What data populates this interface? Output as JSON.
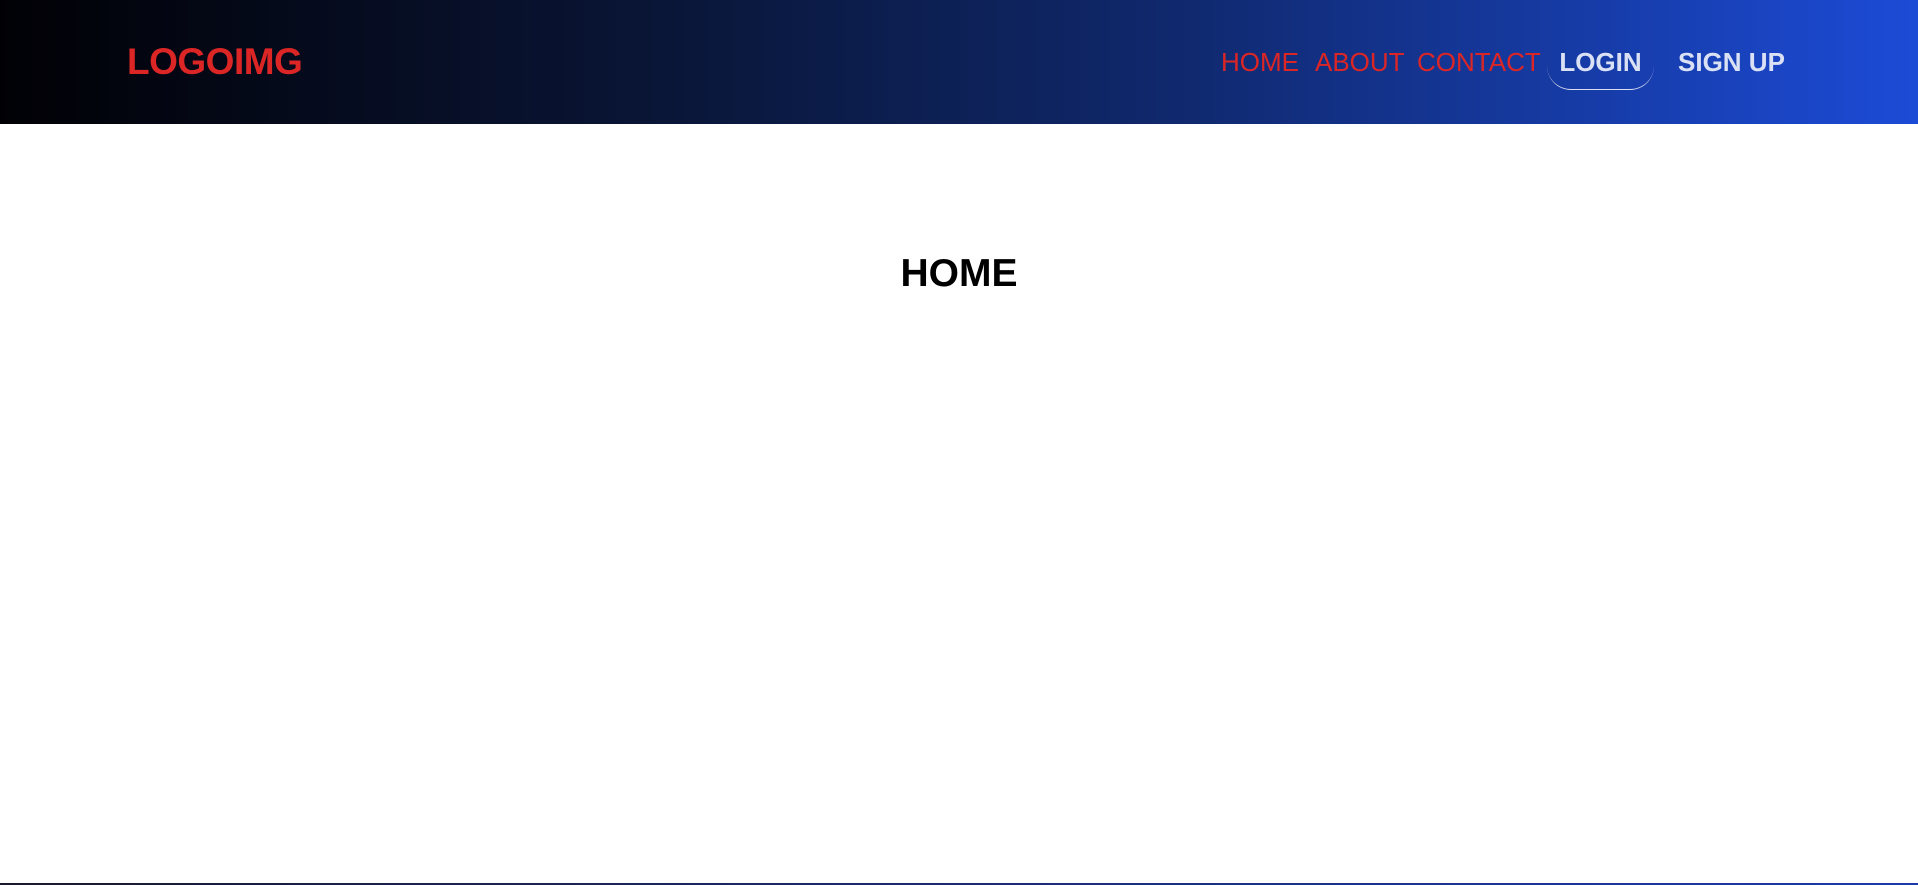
{
  "header": {
    "logo_text": "LOGOIMG",
    "nav": {
      "home": "HOME",
      "about": "ABOUT",
      "contact": "CONTACT"
    },
    "login_label": "LOGIN",
    "signup_label": "SIGN UP"
  },
  "main": {
    "title": "HOME"
  },
  "colors": {
    "brand_red": "#dc2626",
    "nav_gradient_start": "#010105",
    "nav_gradient_end": "#1c4bd6",
    "button_text": "#dbe1f5"
  }
}
